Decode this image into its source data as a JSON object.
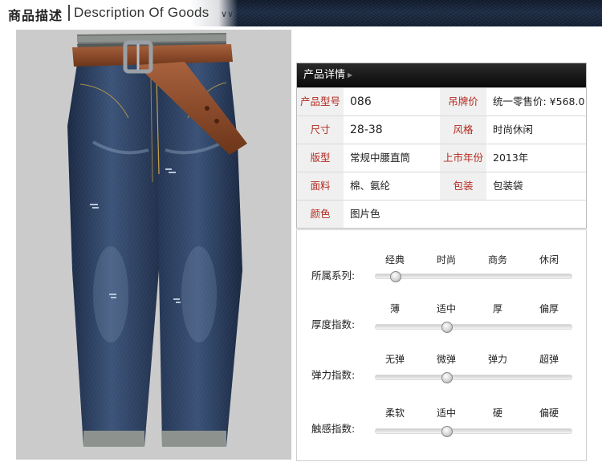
{
  "header": {
    "title_cn": "商品描述",
    "title_en": "Description Of Goods",
    "chevron_icon": "chevron-double-down-icon"
  },
  "photo": {
    "subject": "jeans-with-brown-belt",
    "colors": {
      "denim": "#2b3e5c",
      "belt": "#8a4a2c",
      "background": "#cbcbcb"
    }
  },
  "detail": {
    "header_label": "产品详情",
    "rows": [
      {
        "label1": "产品型号",
        "value1": "086",
        "label2": "吊牌价",
        "value2": "统一零售价: ¥568.0"
      },
      {
        "label1": "尺寸",
        "value1": "28-38",
        "label2": "风格",
        "value2": "时尚休闲"
      },
      {
        "label1": "版型",
        "value1": "常规中腰直筒",
        "label2": "上市年份",
        "value2": "2013年"
      },
      {
        "label1": "面料",
        "value1": "棉、氨纶",
        "label2": "包装",
        "value2": "包装袋"
      },
      {
        "label1": "颜色",
        "value1": "图片色"
      }
    ],
    "label_color": "#b32a1f"
  },
  "attributes": [
    {
      "name": "所属系列:",
      "options": [
        "经典",
        "时尚",
        "商务",
        "休闲"
      ],
      "selected_index": 0
    },
    {
      "name": "厚度指数:",
      "options": [
        "薄",
        "适中",
        "厚",
        "偏厚"
      ],
      "selected_index": 1
    },
    {
      "name": "弹力指数:",
      "options": [
        "无弹",
        "微弹",
        "弹力",
        "超弹"
      ],
      "selected_index": 1
    },
    {
      "name": "触感指数:",
      "options": [
        "柔软",
        "适中",
        "硬",
        "偏硬"
      ],
      "selected_index": 1
    }
  ]
}
